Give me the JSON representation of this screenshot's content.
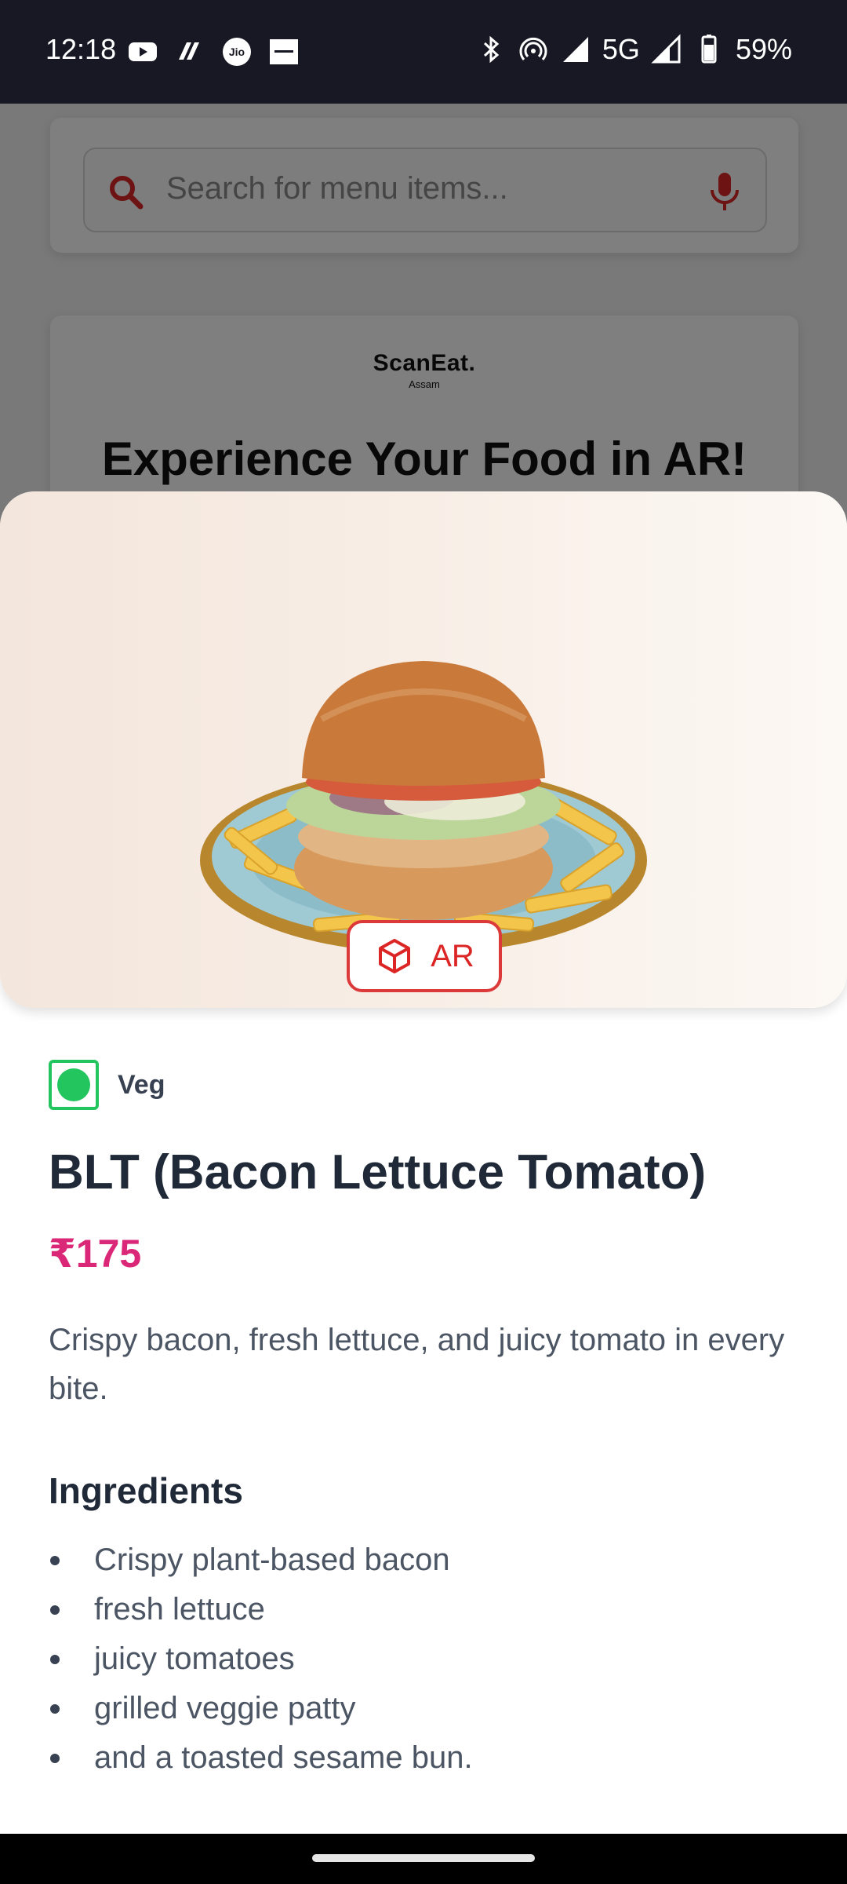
{
  "status_bar": {
    "time": "12:18",
    "left_icons": [
      "youtube-icon",
      "app-icon",
      "jio-icon",
      "zomato-icon"
    ],
    "right_icons": [
      "bluetooth-icon",
      "hotspot-icon",
      "signal-icon",
      "signal-icon-2",
      "battery-icon"
    ],
    "network": "5G",
    "battery": "59%"
  },
  "background_page": {
    "search": {
      "placeholder": "Search for menu items..."
    },
    "logo": {
      "name": "ScanEat.",
      "sub": "Assam"
    },
    "banner_title": "Experience Your Food in AR!"
  },
  "item": {
    "ar_label": "AR",
    "diet": "Veg",
    "title": "BLT (Bacon Lettuce Tomato)",
    "price": "₹175",
    "description": "Crispy bacon, fresh lettuce, and juicy tomato in every bite.",
    "ingredients_heading": "Ingredients",
    "ingredients": [
      "Crispy plant-based bacon",
      "fresh lettuce",
      "juicy tomatoes",
      "grilled veggie patty",
      "and a toasted sesame bun."
    ]
  },
  "colors": {
    "accent_red": "#dc2626",
    "price_pink": "#db2777",
    "veg_green": "#22c55e",
    "status_bar_bg": "#181824"
  }
}
